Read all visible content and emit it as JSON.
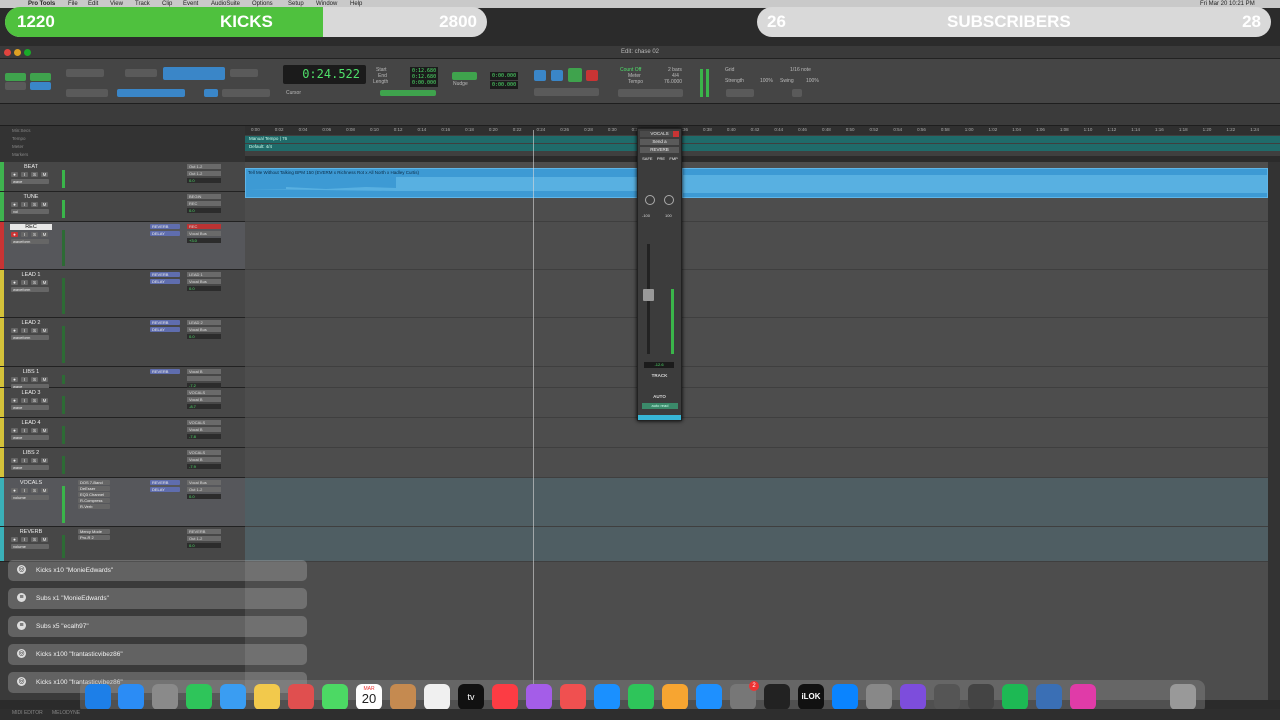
{
  "menubar": {
    "app": "Pro Tools",
    "items": [
      "File",
      "Edit",
      "View",
      "Track",
      "Clip",
      "Event",
      "AudioSuite",
      "Options",
      "Setup",
      "Window",
      "Help"
    ],
    "clock": "Fri Mar 20  10:21 PM"
  },
  "overlay": {
    "kicks": {
      "left": "1220",
      "label": "KICKS",
      "right": "2800",
      "progress": 0.66,
      "color": "#4fc13e"
    },
    "subscribers": {
      "left": "26",
      "label": "SUBSCRIBERS",
      "right": "28",
      "progress": 0.0,
      "color": "#4f6fd8"
    }
  },
  "window": {
    "title": "Edit: chase 02"
  },
  "toolbar": {
    "modes": [
      "SHUFFLE",
      "SPOT",
      "SLIP",
      "GRID"
    ],
    "main_counter": "0:24.522",
    "cursor_label": "Cursor",
    "sel_labels": [
      "Start",
      "End",
      "Length"
    ],
    "sel_values": [
      "0:12.680",
      "0:12.680",
      "0:00.000"
    ],
    "nudge_label": "Nudge",
    "grid_label": "Grid",
    "tempo_label": "Tempo",
    "meter_label": "Meter",
    "meter_value": "4/4",
    "tempo_value": "76.0000",
    "count_off": "Count Off",
    "bars": "2 bars",
    "grid_name": "Grid",
    "grid_value": "1/16 note",
    "strength_label": "Strength",
    "strength_value": "100%",
    "swing_label": "Swing",
    "swing_value": "100%"
  },
  "rulers": {
    "rows": [
      "Min:Secs",
      "Tempo",
      "Meter",
      "Markers"
    ],
    "manual_tempo": "Manual Tempo  | 76",
    "default_meter": "Default: 4/4",
    "ticks": [
      "0:00",
      "0:02",
      "0:04",
      "0:06",
      "0:08",
      "0:10",
      "0:12",
      "0:14",
      "0:16",
      "0:18",
      "0:20",
      "0:22",
      "0:24",
      "0:26",
      "0:28",
      "0:30",
      "0:32",
      "0:34",
      "0:36",
      "0:38",
      "0:40",
      "0:42",
      "0:44",
      "0:46",
      "0:48",
      "0:50",
      "0:52",
      "0:54",
      "0:56",
      "0:58",
      "1:00",
      "1:02",
      "1:04",
      "1:06",
      "1:08",
      "1:10",
      "1:12",
      "1:14",
      "1:16",
      "1:18",
      "1:20",
      "1:22",
      "1:24"
    ]
  },
  "columns": [
    "INSERTS A-E",
    "INSERTS F-J",
    "SENDS A-E",
    "I / O"
  ],
  "tracks": [
    {
      "name": "BEAT",
      "color": "#3fb34f",
      "io_in": "Out 1-2",
      "io_out": "Out 1-2",
      "vol": "0.0",
      "mode": "wave",
      "sends": [],
      "inserts": []
    },
    {
      "name": "TUNE",
      "color": "#3fb34f",
      "io_in": "BEGIN",
      "io_out": "REC",
      "vol": "0.0",
      "mode": "vol",
      "sends": [],
      "inserts": []
    },
    {
      "name": "REC",
      "color": "#c93434",
      "io_in": "REC",
      "io_out": "Vocal Bus",
      "vol": "+3.0",
      "mode": "waveform",
      "sends": [
        "REVERB",
        "DELAY"
      ],
      "inserts": []
    },
    {
      "name": "LEAD 1",
      "color": "#d4c23a",
      "io_in": "LEAD 1",
      "io_out": "Vocal Bus",
      "vol": "0.0",
      "mode": "waveform",
      "sends": [
        "REVERB",
        "DELAY"
      ],
      "inserts": []
    },
    {
      "name": "LEAD 2",
      "color": "#d4c23a",
      "io_in": "LEAD 2",
      "io_out": "Vocal Bus",
      "vol": "0.0",
      "mode": "waveform",
      "sends": [
        "REVERB",
        "DELAY"
      ],
      "inserts": []
    },
    {
      "name": "LIBS 1",
      "color": "#d4c23a",
      "io_in": "Vocal B",
      "io_out": "",
      "vol": "-7.2",
      "mode": "wave",
      "sends": [
        "REVERB"
      ],
      "inserts": []
    },
    {
      "name": "LEAD 3",
      "color": "#d4c23a",
      "io_in": "VOCALS",
      "io_out": "Vocal B",
      "vol": "-8.7",
      "mode": "wave",
      "sends": [],
      "inserts": []
    },
    {
      "name": "LEAD 4",
      "color": "#d4c23a",
      "io_in": "VOCALS",
      "io_out": "Vocal B",
      "vol": "-7.8",
      "mode": "wave",
      "sends": [],
      "inserts": []
    },
    {
      "name": "LIBS 2",
      "color": "#d4c23a",
      "io_in": "VOCALS",
      "io_out": "Vocal B",
      "vol": "-7.9",
      "mode": "wave",
      "sends": [],
      "inserts": []
    },
    {
      "name": "VOCALS",
      "color": "#3ab0b8",
      "io_in": "Vocal Bus",
      "io_out": "Out 1-2",
      "vol": "0.0",
      "mode": "volume",
      "sends": [
        "REVERB",
        "DELAY"
      ],
      "inserts": [
        "DOS 7-Band",
        "DeEsser",
        "EQ3 Channel",
        "R-Compress",
        "R-Verb"
      ]
    },
    {
      "name": "REVERB",
      "color": "#3ab0b8",
      "io_in": "REVERB",
      "io_out": "Out 1-2",
      "vol": "0.0",
      "mode": "volume",
      "sends": [],
      "inserts": [
        "Mercy Mode",
        "Pro-R 2"
      ]
    }
  ],
  "clip": {
    "title": "Tell Me Without Talking BPM 150 (EVERM x Richness Rot x All North x Hadley Curtis)"
  },
  "output_window": {
    "title": "VOCALS",
    "send": "Send a",
    "route": "REVERB",
    "buttons": [
      "SAFE",
      "PRE",
      "FMP"
    ],
    "pan": [
      "-100",
      "100"
    ],
    "fader_value": "-12.6",
    "track_label": "TRACK",
    "auto_label": "AUTO",
    "auto_mode": "auto read"
  },
  "notifications": [
    {
      "text": "Kicks x10 \"MonieEdwards\"",
      "icon": "kick-icon"
    },
    {
      "text": "Subs x1 \"MonieEdwards\"",
      "icon": "sub-icon"
    },
    {
      "text": "Subs x5 \"ecalh97\"",
      "icon": "sub-icon"
    },
    {
      "text": "Kicks x100 \"frantasticvibez86\"",
      "icon": "kick-icon"
    },
    {
      "text": "Kicks x100 \"frantasticvibez86\"",
      "icon": "kick-icon"
    }
  ],
  "dock": {
    "calendar_month": "MAR",
    "calendar_day": "20",
    "tv_label": "tv",
    "ilok_label": "iLOK",
    "badge": "2"
  },
  "bottom": {
    "left": "MIDI EDITOR",
    "mid": "MELODYNE"
  }
}
